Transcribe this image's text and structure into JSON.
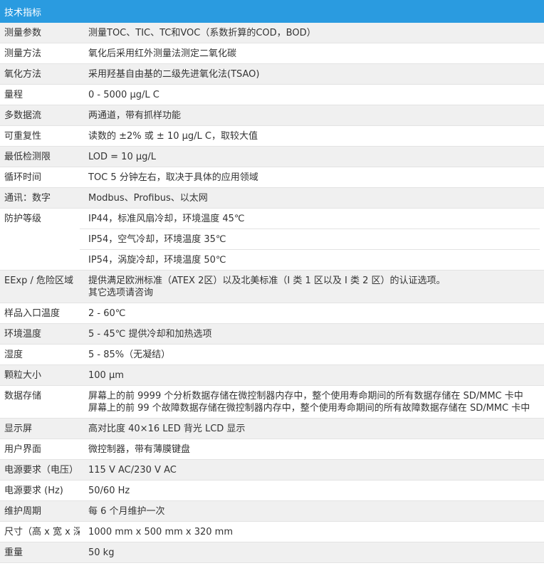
{
  "header": {
    "title": "技术指标"
  },
  "rows": [
    {
      "label": "测量参数",
      "values": [
        "测量TOC、TIC、TC和VOC（系数折算的COD，BOD）"
      ],
      "split": false
    },
    {
      "label": "测量方法",
      "values": [
        "氧化后采用红外测量法测定二氧化碳"
      ],
      "split": false
    },
    {
      "label": "氧化方法",
      "values": [
        "采用羟基自由基的二级先进氧化法(TSAO)"
      ],
      "split": false
    },
    {
      "label": "量程",
      "values": [
        "0 - 5000 µg/L C"
      ],
      "split": false
    },
    {
      "label": "多数据流",
      "values": [
        "两通道，带有抓样功能"
      ],
      "split": false
    },
    {
      "label": "可重复性",
      "values": [
        "读数的 ±2% 或 ± 10 µg/L C，取较大值"
      ],
      "split": false
    },
    {
      "label": "最低检测限",
      "values": [
        "LOD = 10 µg/L"
      ],
      "split": false
    },
    {
      "label": "循环时间",
      "values": [
        "TOC 5 分钟左右，取决于具体的应用领域"
      ],
      "split": false
    },
    {
      "label": "通讯：数字",
      "values": [
        "Modbus、Profibus、以太网"
      ],
      "split": false
    },
    {
      "label": "防护等级",
      "values": [
        "IP44，标准风扇冷却，环境温度 45℃",
        "IP54，空气冷却，环境温度 35℃",
        "IP54，涡旋冷却，环境温度 50℃"
      ],
      "split": true
    },
    {
      "label": "EExp / 危险区域",
      "values": [
        "提供满足欧洲标准（ATEX 2区）以及北美标准（I 类 1 区以及 I 类 2 区）的认证选项。",
        "其它选项请咨询"
      ],
      "split": false
    },
    {
      "label": "样品入口温度",
      "values": [
        "2 - 60℃"
      ],
      "split": false
    },
    {
      "label": "环境温度",
      "values": [
        "5 - 45℃ 提供冷却和加热选项"
      ],
      "split": false
    },
    {
      "label": "湿度",
      "values": [
        "5 - 85%（无凝结）"
      ],
      "split": false
    },
    {
      "label": "颗粒大小",
      "values": [
        "100 µm"
      ],
      "split": false
    },
    {
      "label": "数据存储",
      "values": [
        "屏幕上的前 9999 个分析数据存储在微控制器内存中，整个使用寿命期间的所有数据存储在 SD/MMC 卡中",
        "屏幕上的前 99 个故障数据存储在微控制器内存中，整个使用寿命期间的所有故障数据存储在 SD/MMC 卡中"
      ],
      "split": false
    },
    {
      "label": "显示屏",
      "values": [
        "高对比度 40×16 LED 背光 LCD 显示"
      ],
      "split": false
    },
    {
      "label": "用户界面",
      "values": [
        "微控制器，带有薄膜键盘"
      ],
      "split": false
    },
    {
      "label": "电源要求（电压）",
      "values": [
        "115 V AC/230 V AC"
      ],
      "split": false
    },
    {
      "label": "电源要求 (Hz)",
      "values": [
        "50/60 Hz"
      ],
      "split": false
    },
    {
      "label": "维护周期",
      "values": [
        "每 6 个月维护一次"
      ],
      "split": false
    },
    {
      "label": "尺寸（高 x 宽 x 深）",
      "values": [
        "1000 mm x 500 mm x 320 mm"
      ],
      "split": false
    },
    {
      "label": "重量",
      "values": [
        "50 kg"
      ],
      "split": false
    }
  ]
}
